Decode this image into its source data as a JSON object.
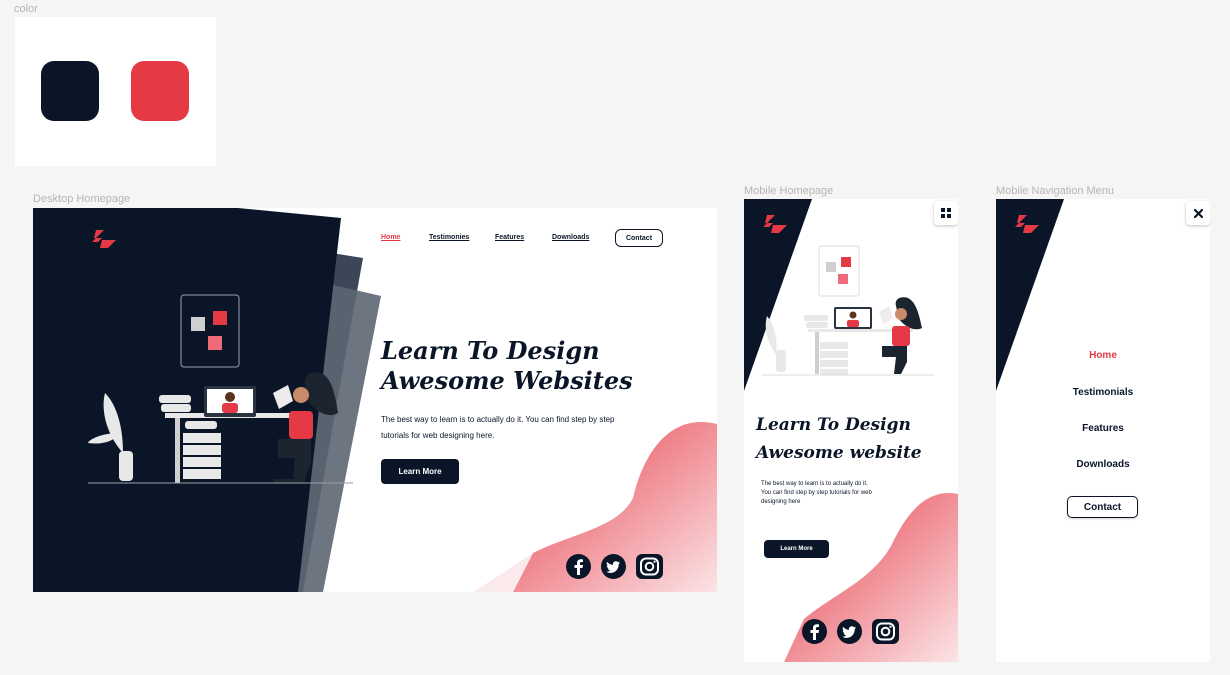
{
  "labels": {
    "color": "color",
    "desktop": "Desktop Homepage",
    "mobile": "Mobile Homepage",
    "nav": "Mobile Navigation Menu"
  },
  "colors": {
    "navy": "#0a1628",
    "red": "#e63946"
  },
  "desktop": {
    "nav": {
      "home": "Home",
      "testimonies": "Testimonies",
      "features": "Features",
      "downloads": "Downloads",
      "contact": "Contact"
    },
    "headline_1": "Learn To Design",
    "headline_2": "Awesome Websites",
    "body_1": "The best way to learn is to actually do it. You can find step by step",
    "body_2": "tutorials for web designing here.",
    "cta": "Learn More"
  },
  "mobile": {
    "headline_1": "Learn To Design",
    "headline_2": "Awesome website",
    "body_1": "The best way to learn is to actually do it.",
    "body_2": "You can find step by step tutorials for web",
    "body_3": "designing here",
    "cta": "Learn More"
  },
  "menu": {
    "items": [
      "Home",
      "Testimonials",
      "Features",
      "Downloads"
    ],
    "contact": "Contact"
  },
  "icons": [
    "logo-icon",
    "facebook-icon",
    "twitter-icon",
    "instagram-icon",
    "grid-menu-icon",
    "close-icon"
  ]
}
